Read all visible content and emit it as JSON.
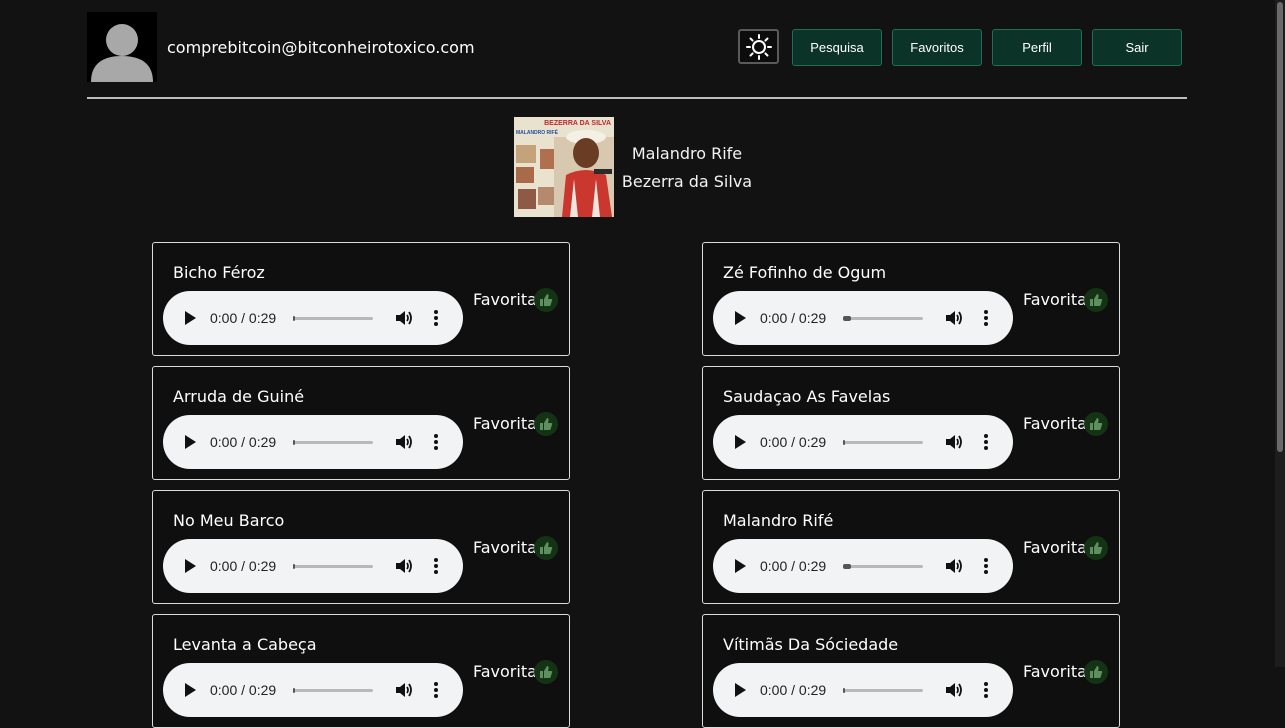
{
  "header": {
    "email": "comprebitcoin@bitconheirotoxico.com",
    "nav": [
      {
        "label": "Pesquisa"
      },
      {
        "label": "Favoritos"
      },
      {
        "label": "Perfil"
      },
      {
        "label": "Sair"
      }
    ]
  },
  "album": {
    "title": "Malandro Rife",
    "artist": "Bezerra da Silva",
    "cover_text": "BEZERRA DA SILVA",
    "cover_subtext": "MALANDRO RIFÉ"
  },
  "fav_label": "Favorita",
  "tracks": [
    {
      "title": "Bicho Féroz",
      "time": "0:00 / 0:29",
      "progress": 0.03
    },
    {
      "title": "Zé Fofinho de Ogum",
      "time": "0:00 / 0:29",
      "progress": 0.1
    },
    {
      "title": "Arruda de Guiné",
      "time": "0:00 / 0:29",
      "progress": 0.03
    },
    {
      "title": "Saudaçao As Favelas",
      "time": "0:00 / 0:29",
      "progress": 0.03
    },
    {
      "title": "No Meu Barco",
      "time": "0:00 / 0:29",
      "progress": 0.03
    },
    {
      "title": "Malandro Rifé",
      "time": "0:00 / 0:29",
      "progress": 0.1
    },
    {
      "title": "Levanta a Cabeça",
      "time": "0:00 / 0:29",
      "progress": 0.03
    },
    {
      "title": "Vítimãs Da Sóciedade",
      "time": "0:00 / 0:29",
      "progress": 0.03
    }
  ],
  "colors": {
    "background": "#121212",
    "button_bg": "#0b3327",
    "thumb_bg": "#143214"
  },
  "icons": {
    "theme": "sun-icon",
    "favorite": "thumbs-up-icon",
    "avatar": "user-silhouette-icon"
  }
}
